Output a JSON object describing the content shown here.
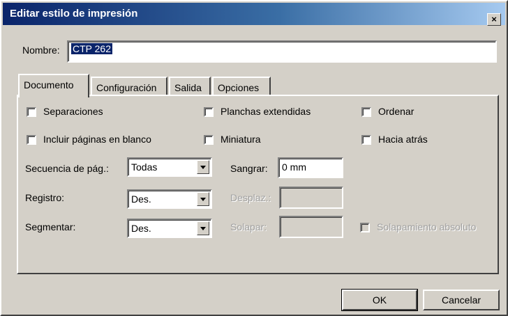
{
  "window": {
    "title": "Editar estilo de impresión",
    "close": "×"
  },
  "name": {
    "label": "Nombre:",
    "value": "CTP 262"
  },
  "tabs": [
    {
      "label": "Documento",
      "active": true
    },
    {
      "label": "Configuración",
      "active": false
    },
    {
      "label": "Salida",
      "active": false
    },
    {
      "label": "Opciones",
      "active": false
    }
  ],
  "options": {
    "separaciones": {
      "label": "Separaciones",
      "checked": false
    },
    "planchas_extendidas": {
      "label": "Planchas extendidas",
      "checked": false
    },
    "ordenar": {
      "label": "Ordenar",
      "checked": false
    },
    "incluir_paginas": {
      "label": "Incluir páginas en blanco",
      "checked": false
    },
    "miniatura": {
      "label": "Miniatura",
      "checked": false
    },
    "hacia_atras": {
      "label": "Hacia atrás",
      "checked": false
    },
    "solapamiento_absoluto": {
      "label": "Solapamiento absoluto",
      "checked": false,
      "disabled": true
    }
  },
  "fields": {
    "secuencia": {
      "label": "Secuencia de pág.:",
      "value": "Todas"
    },
    "registro": {
      "label": "Registro:",
      "value": "Des."
    },
    "segmentar": {
      "label": "Segmentar:",
      "value": "Des."
    },
    "sangrar": {
      "label": "Sangrar:",
      "value": "0 mm"
    },
    "desplaz": {
      "label": "Desplaz.:",
      "value": "",
      "disabled": true
    },
    "solapar": {
      "label": "Solapar:",
      "value": "",
      "disabled": true
    }
  },
  "buttons": {
    "ok": "OK",
    "cancel": "Cancelar"
  }
}
